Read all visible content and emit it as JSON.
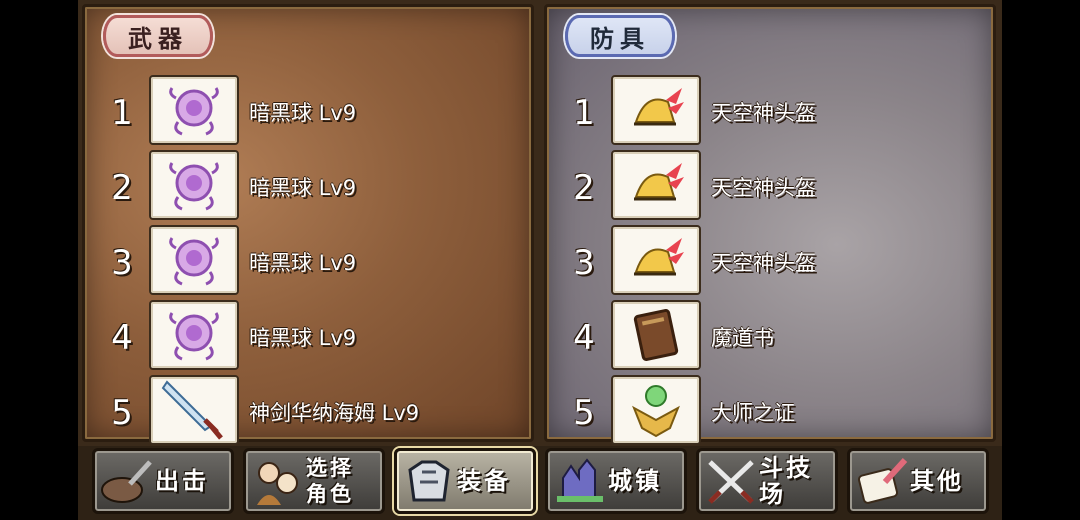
{
  "weapons": {
    "tag": "武器",
    "items": [
      {
        "num": "1",
        "name": "暗黑球 Lv9",
        "icon": "dark-orb-icon"
      },
      {
        "num": "2",
        "name": "暗黑球 Lv9",
        "icon": "dark-orb-icon"
      },
      {
        "num": "3",
        "name": "暗黑球 Lv9",
        "icon": "dark-orb-icon"
      },
      {
        "num": "4",
        "name": "暗黑球 Lv9",
        "icon": "dark-orb-icon"
      },
      {
        "num": "5",
        "name": "神剑华纳海姆 Lv9",
        "icon": "sword-icon"
      }
    ]
  },
  "armor": {
    "tag": "防具",
    "items": [
      {
        "num": "1",
        "name": "天空神头盔",
        "icon": "winged-helmet-icon"
      },
      {
        "num": "2",
        "name": "天空神头盔",
        "icon": "winged-helmet-icon"
      },
      {
        "num": "3",
        "name": "天空神头盔",
        "icon": "winged-helmet-icon"
      },
      {
        "num": "4",
        "name": "魔道书",
        "icon": "spellbook-icon"
      },
      {
        "num": "5",
        "name": "大师之证",
        "icon": "master-emblem-icon"
      }
    ]
  },
  "nav": {
    "sortie": "出击",
    "select_character": "选择角色",
    "equipment": "装备",
    "town": "城镇",
    "arena": "斗技场",
    "other": "其他"
  },
  "colors": {
    "weapon_panel": "#8e5f3c",
    "armor_panel": "#8b8489",
    "weapon_tag_border": "#b25b5b",
    "armor_tag_border": "#5b6ab2"
  }
}
